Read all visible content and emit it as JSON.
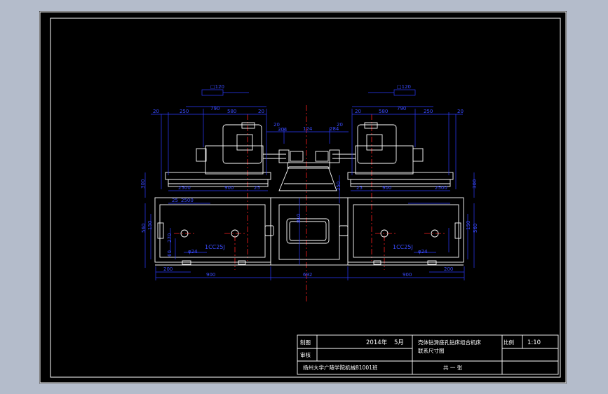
{
  "colors": {
    "viewport_bg": "#b4bccb",
    "sheet_bg": "#000000",
    "frame": "#ffffff",
    "drawing": "#ffffff",
    "dimension": "#2b3bff",
    "centerline": "#ff2020"
  },
  "dimensions": {
    "top_left_a": "20",
    "top_left_b": "250",
    "top_left_c": "790",
    "top_left_d": "580",
    "top_left_e": "20",
    "top_right_a": "20",
    "top_right_b": "250",
    "top_right_c": "790",
    "top_right_d": "580",
    "top_right_e": "20",
    "left_stroke": "304",
    "left_offset": "20",
    "center_a": "124",
    "center_b": "284",
    "center_c": "20",
    "spindle_left": "□120",
    "spindle_right": "□120",
    "left_height": "300",
    "right_height": "300",
    "slide_left_a": "900",
    "slide_left_b": "25",
    "slide_left_c": "2500",
    "slide_right_a": "900",
    "slide_right_b": "25",
    "slide_right_c": "2500",
    "left_v1": "560",
    "left_v2": "150",
    "left_v3": "270",
    "left_v4": "60",
    "right_v1": "560",
    "right_v2": "150",
    "center_v": "810",
    "center_v2": "250",
    "dia_left": "φ24",
    "dia_right": "φ24",
    "base_left": "1CC25J",
    "base_right": "1CC25J",
    "bottom_left_small": "200",
    "bottom_right_small": "200",
    "bottom_left": "900",
    "bottom_center": "692",
    "bottom_right": "900",
    "small_a": "25",
    "small_b": "2500"
  },
  "title_block": {
    "label_drawn": "制图",
    "label_review": "审核",
    "date_year": "2014年",
    "date_month": "5月",
    "title_line1": "壳体钻滑座孔钻床组合机床",
    "title_line2": "联系尺寸图",
    "scale_label": "比例",
    "scale_value": "1:10",
    "school": "扬州大学广陵学院机械81001班",
    "sheet": "共  一  张"
  }
}
